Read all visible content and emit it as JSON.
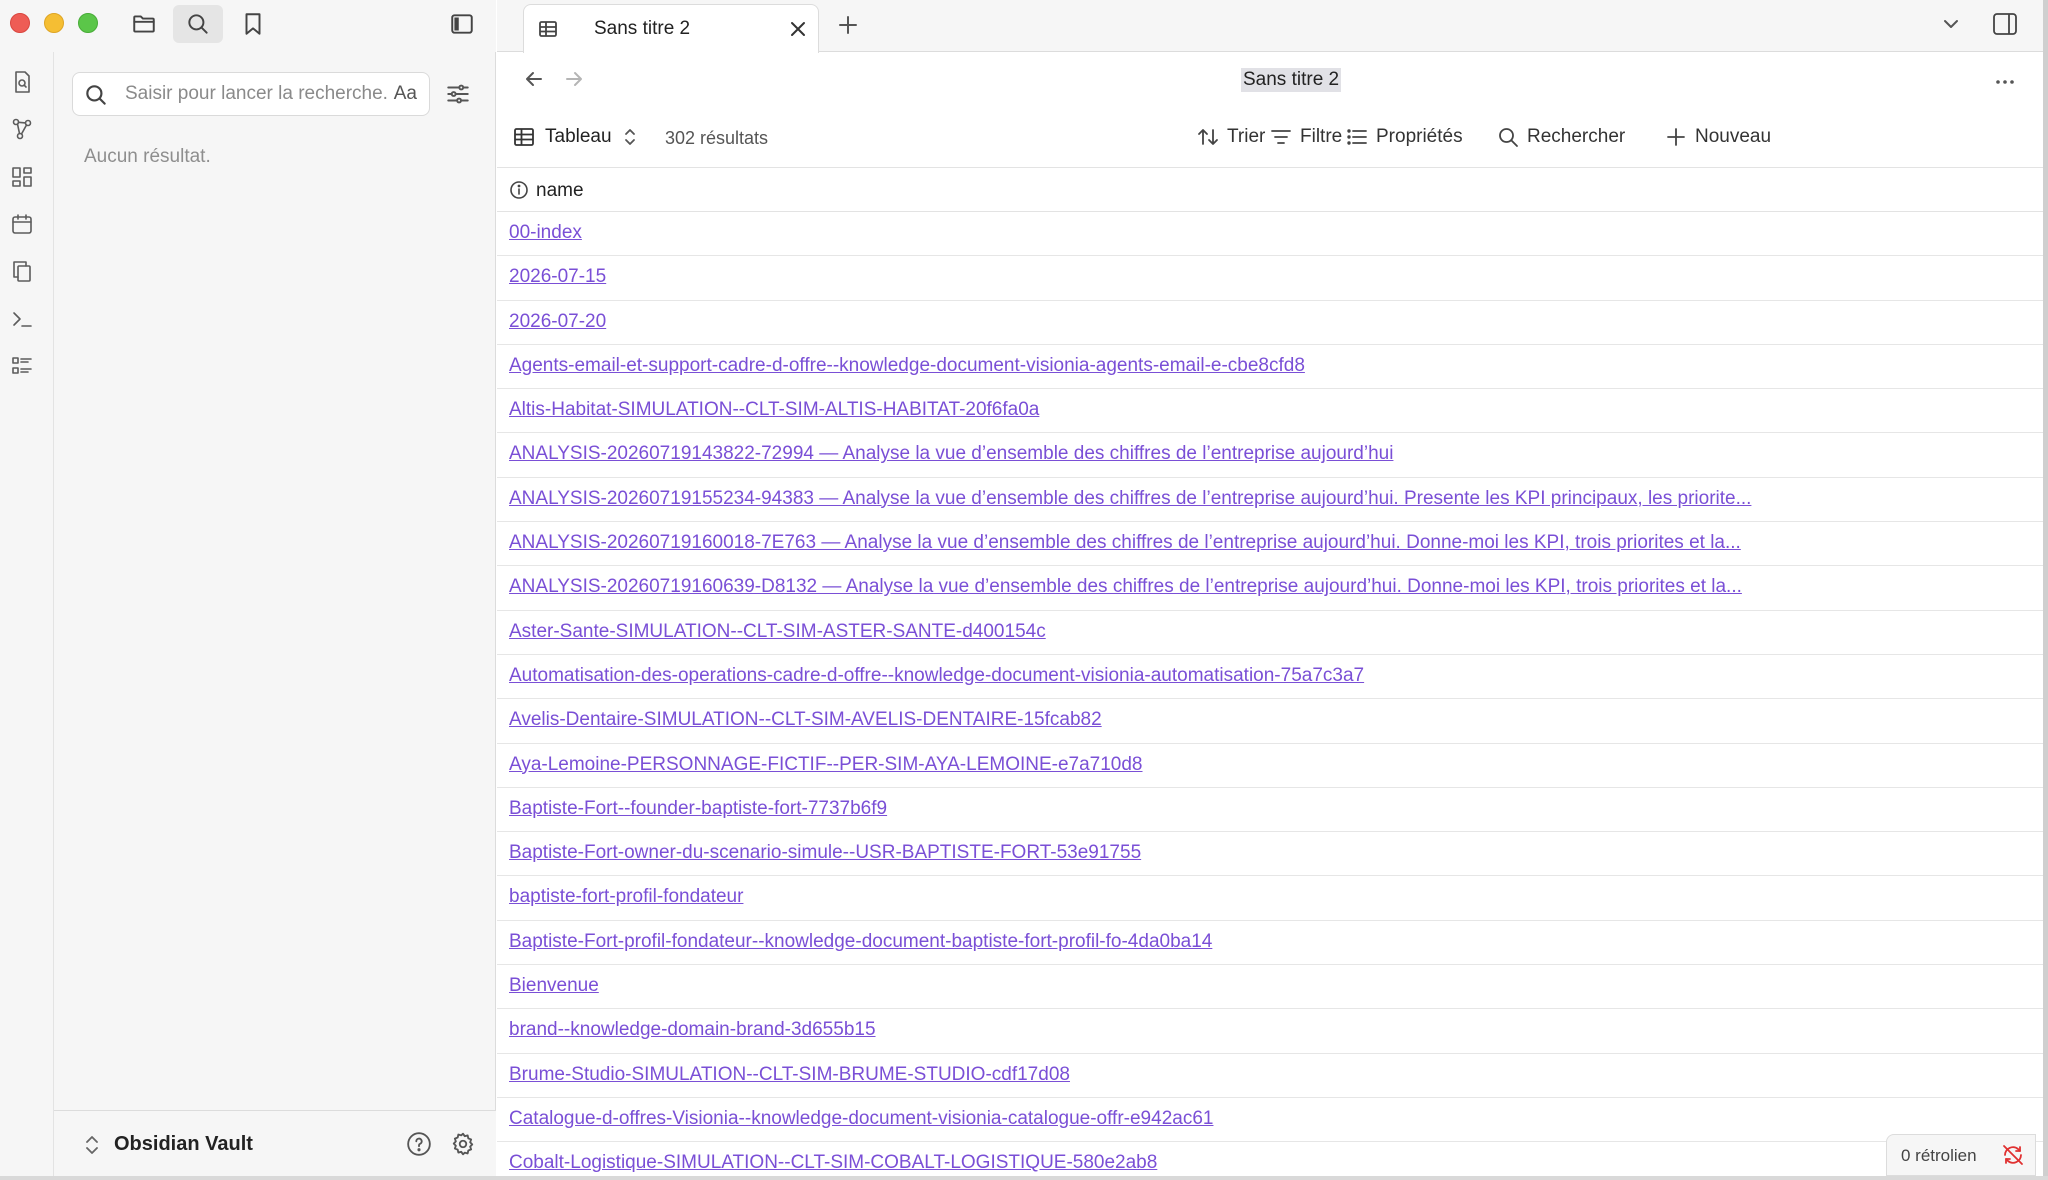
{
  "search": {
    "placeholder": "Saisir pour lancer la recherche...",
    "match_case_label": "Aa",
    "no_results": "Aucun résultat."
  },
  "vault": {
    "name": "Obsidian Vault"
  },
  "tab": {
    "title": "Sans titre 2"
  },
  "nav": {
    "title": "Sans titre 2"
  },
  "toolbar": {
    "view_label": "Tableau",
    "result_count": "302 résultats",
    "sort_label": "Trier",
    "filter_label": "Filtre",
    "properties_label": "Propriétés",
    "search_label": "Rechercher",
    "new_label": "Nouveau"
  },
  "table": {
    "column": "name",
    "rows": [
      "00-index",
      "2026-07-15",
      "2026-07-20",
      "Agents-email-et-support-cadre-d-offre--knowledge-document-visionia-agents-email-e-cbe8cfd8",
      "Altis-Habitat-SIMULATION--CLT-SIM-ALTIS-HABITAT-20f6fa0a",
      "ANALYSIS-20260719143822-72994 — Analyse la vue d’ensemble des chiffres de l’entreprise aujourd’hui",
      "ANALYSIS-20260719155234-94383 — Analyse la vue d’ensemble des chiffres de l’entreprise aujourd’hui. Presente les KPI principaux, les priorite...",
      "ANALYSIS-20260719160018-7E763 — Analyse la vue d’ensemble des chiffres de l’entreprise aujourd’hui. Donne-moi les KPI, trois priorites et la...",
      "ANALYSIS-20260719160639-D8132 — Analyse la vue d’ensemble des chiffres de l’entreprise aujourd’hui. Donne-moi les KPI, trois priorites et la...",
      "Aster-Sante-SIMULATION--CLT-SIM-ASTER-SANTE-d400154c",
      "Automatisation-des-operations-cadre-d-offre--knowledge-document-visionia-automatisation-75a7c3a7",
      "Avelis-Dentaire-SIMULATION--CLT-SIM-AVELIS-DENTAIRE-15fcab82",
      "Aya-Lemoine-PERSONNAGE-FICTIF--PER-SIM-AYA-LEMOINE-e7a710d8",
      "Baptiste-Fort--founder-baptiste-fort-7737b6f9",
      "Baptiste-Fort-owner-du-scenario-simule--USR-BAPTISTE-FORT-53e91755",
      "baptiste-fort-profil-fondateur",
      "Baptiste-Fort-profil-fondateur--knowledge-document-baptiste-fort-profil-fo-4da0ba14",
      "Bienvenue",
      "brand--knowledge-domain-brand-3d655b15",
      "Brume-Studio-SIMULATION--CLT-SIM-BRUME-STUDIO-cdf17d08",
      "Catalogue-d-offres-Visionia--knowledge-document-visionia-catalogue-offr-e942ac61",
      "Cobalt-Logistique-SIMULATION--CLT-SIM-COBALT-LOGISTIQUE-580e2ab8"
    ]
  },
  "status": {
    "backlinks": "0 rétrolien"
  },
  "colors": {
    "link": "#7a4fd6",
    "sync_error": "#e03131"
  }
}
